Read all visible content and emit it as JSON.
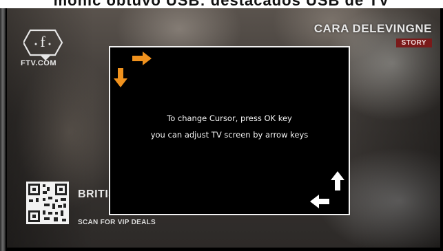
{
  "caption": {
    "text": "mohic obtuvo USB: destacados USB de TV"
  },
  "channel": {
    "logo_letter": "f",
    "site": "FTV.COM"
  },
  "show": {
    "name": "CARA DELEVINGNE",
    "tag": "STORY"
  },
  "promo": {
    "title": "BRITIS",
    "subtitle": "SCAN FOR VIP DEALS"
  },
  "dialog": {
    "line1": "To change Cursor, press OK key",
    "line2": "you can adjust TV screen by arrow keys"
  },
  "icons": {
    "top_left_right": "arrow-right-icon",
    "top_left_down": "arrow-down-icon",
    "bottom_right_up": "arrow-up-icon",
    "bottom_right_left": "arrow-left-icon"
  },
  "colors": {
    "active_arrow": "#f0921e",
    "inactive_arrow": "#ffffff",
    "dialog_bg": "#000000",
    "dialog_border": "#f2f2f2",
    "story_tag": "#7a1a1a"
  }
}
